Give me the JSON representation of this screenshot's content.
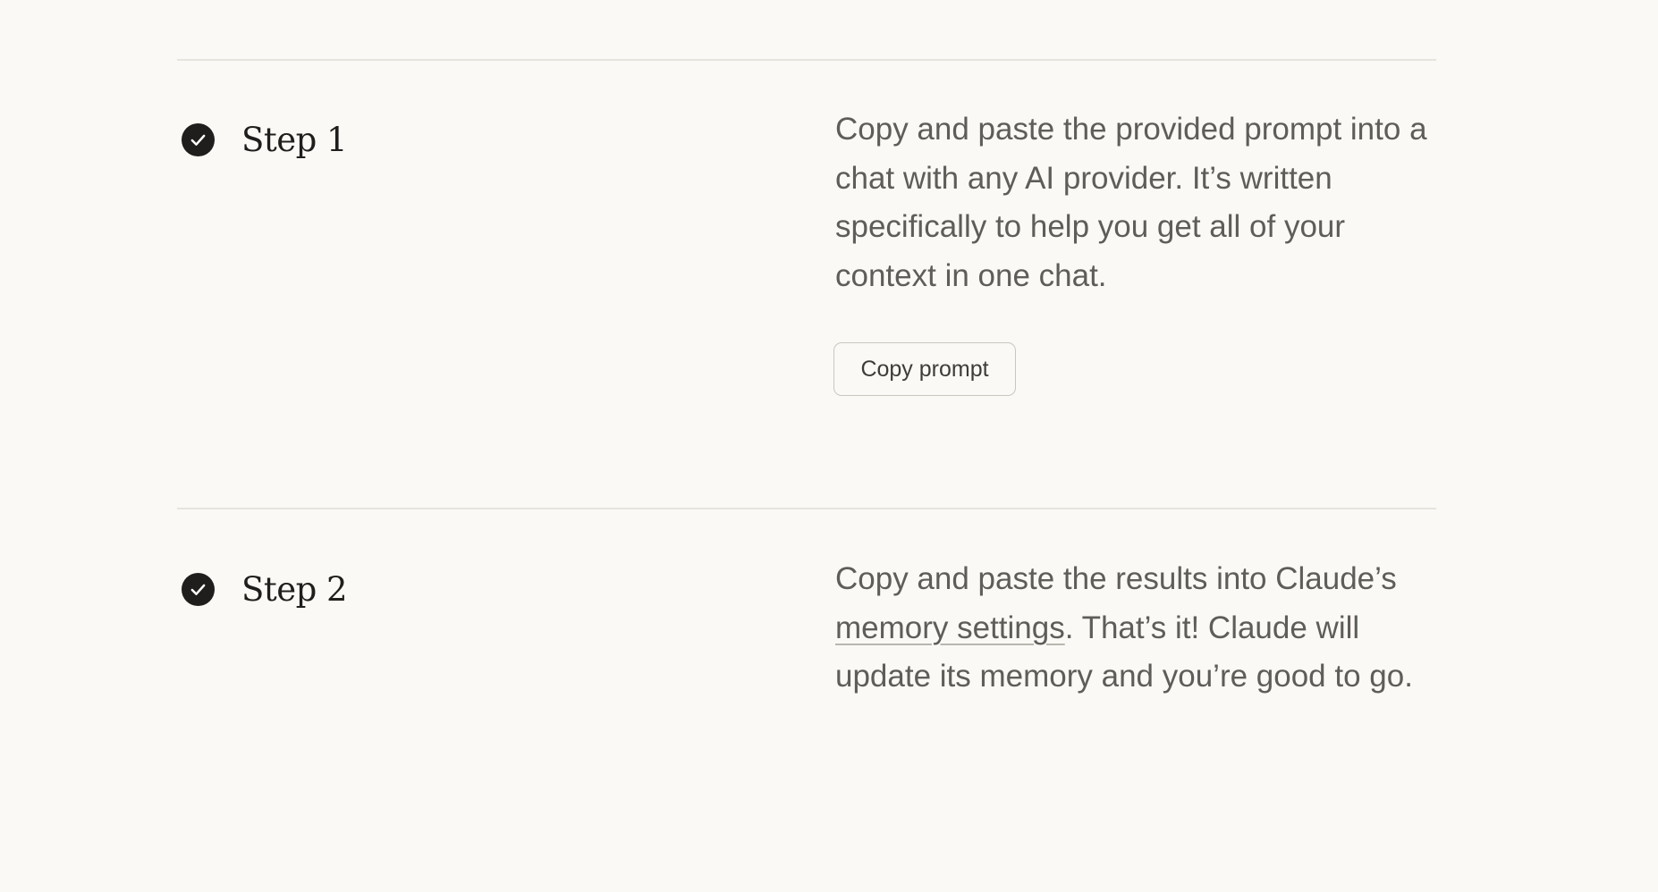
{
  "steps": [
    {
      "title": "Step 1",
      "icon": "check-circle-icon",
      "text": "Copy and paste the provided prompt into a chat with any AI provider. It’s written specifically to help you get all of your context in one chat.",
      "button_label": "Copy prompt"
    },
    {
      "title": "Step 2",
      "icon": "check-circle-icon",
      "text_before": "Copy and paste the results into Claude’s ",
      "link_label": "memory settings",
      "text_after": ". That’s it! Claude will update its memory and you’re good to go."
    }
  ],
  "colors": {
    "background": "#faf9f5",
    "divider": "#e6e4dd",
    "icon": "#1f1e1d",
    "body_text": "#5e5d59"
  }
}
